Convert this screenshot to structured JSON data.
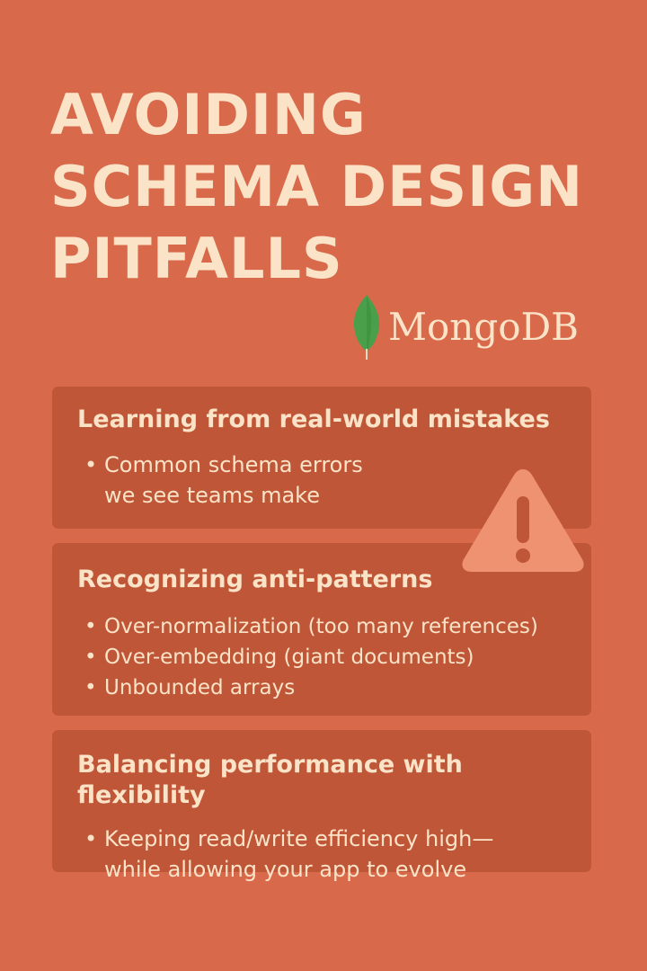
{
  "title": {
    "line1": "AVOIDING",
    "line2": "SCHEMA DESIGN",
    "line3": "PITFALLS"
  },
  "brand": {
    "name": "MongoDB",
    "icon": "mongodb-leaf-icon",
    "leaf_color": "#4aa04a"
  },
  "sections": [
    {
      "heading": "Learning from real-world mistakes",
      "bullets": [
        "Common schema errors we see teams make"
      ]
    },
    {
      "heading": "Recognizing anti-patterns",
      "bullets": [
        "Over-normalization (too many references)",
        "Over-embedding (giant documents)",
        "Unbounded arrays"
      ]
    },
    {
      "heading": "Balancing performance with flexibility",
      "bullets": [
        "Keeping read/write efficiency high—while allowing your app to evolve"
      ]
    }
  ],
  "warning_icon": "warning-triangle-icon",
  "colors": {
    "background": "#d8694a",
    "card": "#bf5638",
    "text": "#fbe3c8",
    "warning": "#ef9272",
    "warning_mark": "#bf5638"
  }
}
